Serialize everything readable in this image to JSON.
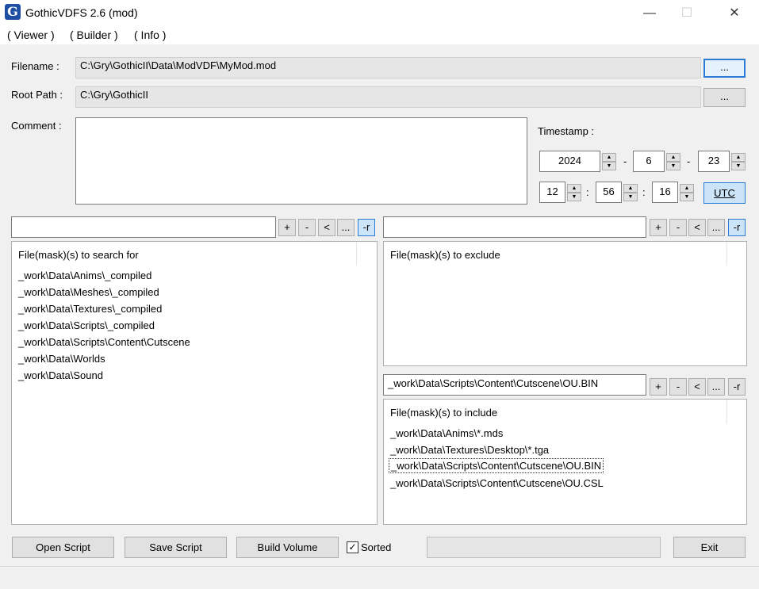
{
  "window": {
    "title": "GothicVDFS 2.6 (mod)",
    "icon_letter": "G",
    "minimize": "—",
    "maximize": "☐",
    "close": "✕"
  },
  "menu": [
    "( Viewer )",
    "( Builder )",
    "( Info )"
  ],
  "filename": {
    "label": "Filename :",
    "value": "C:\\Gry\\GothicII\\Data\\ModVDF\\MyMod.mod",
    "browse": "..."
  },
  "rootpath": {
    "label": "Root Path :",
    "value": "C:\\Gry\\GothicII",
    "browse": "..."
  },
  "comment": {
    "label": "Comment :",
    "value": ""
  },
  "timestamp": {
    "label": "Timestamp :",
    "year": "2024",
    "month": "6",
    "day": "23",
    "hour": "12",
    "minute": "56",
    "second": "16",
    "date_sep": "-",
    "time_sep": ":",
    "utc": "UTC"
  },
  "spin": {
    "up": "▲",
    "down": "▼"
  },
  "search_panel": {
    "input": "",
    "buttons": [
      "+",
      "-",
      "<",
      "...",
      "-r"
    ],
    "header": "File(mask)(s) to search for",
    "items": [
      "_work\\Data\\Anims\\_compiled",
      "_work\\Data\\Meshes\\_compiled",
      "_work\\Data\\Textures\\_compiled",
      "_work\\Data\\Scripts\\_compiled",
      "_work\\Data\\Scripts\\Content\\Cutscene",
      "_work\\Data\\Worlds",
      "_work\\Data\\Sound"
    ]
  },
  "exclude_panel": {
    "input": "",
    "buttons": [
      "+",
      "-",
      "<",
      "...",
      "-r"
    ],
    "header": "File(mask)(s) to exclude",
    "items": []
  },
  "include_panel": {
    "input": "_work\\Data\\Scripts\\Content\\Cutscene\\OU.BIN",
    "buttons": [
      "+",
      "-",
      "<",
      "...",
      "-r"
    ],
    "header": "File(mask)(s) to include",
    "items": [
      "_work\\Data\\Anims\\*.mds",
      "_work\\Data\\Textures\\Desktop\\*.tga",
      "_work\\Data\\Scripts\\Content\\Cutscene\\OU.BIN",
      "_work\\Data\\Scripts\\Content\\Cutscene\\OU.CSL"
    ],
    "selected_index": 2
  },
  "bottom": {
    "open_script": "Open Script",
    "save_script": "Save Script",
    "build_volume": "Build Volume",
    "sorted_label": "Sorted",
    "sorted_checked": "✓",
    "exit": "Exit"
  }
}
